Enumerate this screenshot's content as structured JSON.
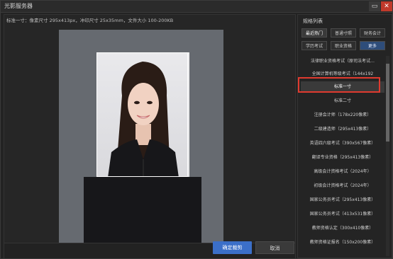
{
  "window": {
    "title": "光影服务器"
  },
  "left_panel": {
    "info": "标准一寸：像素尺寸 295x413px，冲印尺寸 25x35mm，文件大小 100-200KB"
  },
  "footer": {
    "ok_label": "确定裁剪",
    "cancel_label": "取消"
  },
  "right_panel": {
    "title": "规格列表",
    "tabs": [
      {
        "label": "最近热门",
        "active": true
      },
      {
        "label": "普通寸照",
        "active": false
      },
      {
        "label": "财务会计",
        "active": false
      },
      {
        "label": "学历考试",
        "active": false
      },
      {
        "label": "职业资格",
        "active": false
      },
      {
        "label": "更多",
        "active": false
      }
    ],
    "items": [
      "法律职业资格考试（原司法考试…",
      "全国计算机等级考试（144x192",
      "标准一寸",
      "标准二寸",
      "注册会计师（178x220像素）",
      "二级建造师（295x413像素）",
      "英语四六级考试（390x567像素）",
      "翻译专业资格（295x413像素）",
      "高级会计资格考试（2024年）",
      "初级会计资格考试（2024年）",
      "国家公务员考试（295x413像素）",
      "国家公务员考试（413x531像素）",
      "教师资格认定（300x410像素）",
      "教师资格证报名（150x200像素）"
    ],
    "selected_index": 2
  },
  "icons": {
    "minimize": "minimize-icon",
    "close": "close-icon"
  },
  "colors": {
    "accent": "#3b6fc8",
    "highlight": "#e03a2f"
  }
}
